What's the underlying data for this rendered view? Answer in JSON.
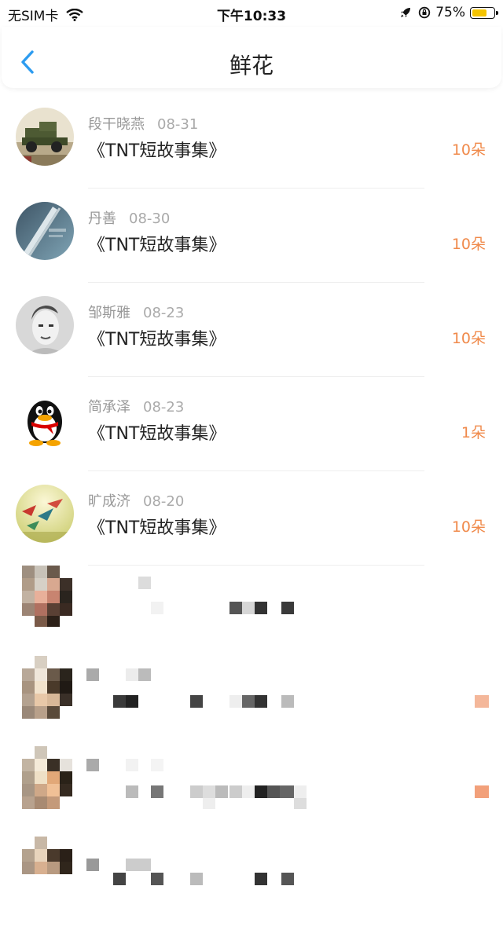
{
  "status_bar": {
    "carrier": "无SIM卡",
    "time": "下午10:33",
    "battery_percent": "75%",
    "battery_level": 0.75,
    "icons": [
      "wifi-icon",
      "rocket-icon",
      "rotation-lock-icon",
      "battery-icon"
    ]
  },
  "header": {
    "title": "鲜花",
    "back_icon": "chevron-left-icon",
    "accent_color": "#2d9cf0"
  },
  "gifts": [
    {
      "name": "段干晓燕",
      "date": "08-31",
      "book": "《TNT短故事集》",
      "count": "10朵"
    },
    {
      "name": "丹善",
      "date": "08-30",
      "book": "《TNT短故事集》",
      "count": "10朵"
    },
    {
      "name": "邹斯雅",
      "date": "08-23",
      "book": "《TNT短故事集》",
      "count": "10朵"
    },
    {
      "name": "简承泽",
      "date": "08-23",
      "book": "《TNT短故事集》",
      "count": "1朵"
    },
    {
      "name": "旷成济",
      "date": "08-20",
      "book": "《TNT短故事集》",
      "count": "10朵"
    }
  ],
  "count_color": "#f08a4b"
}
